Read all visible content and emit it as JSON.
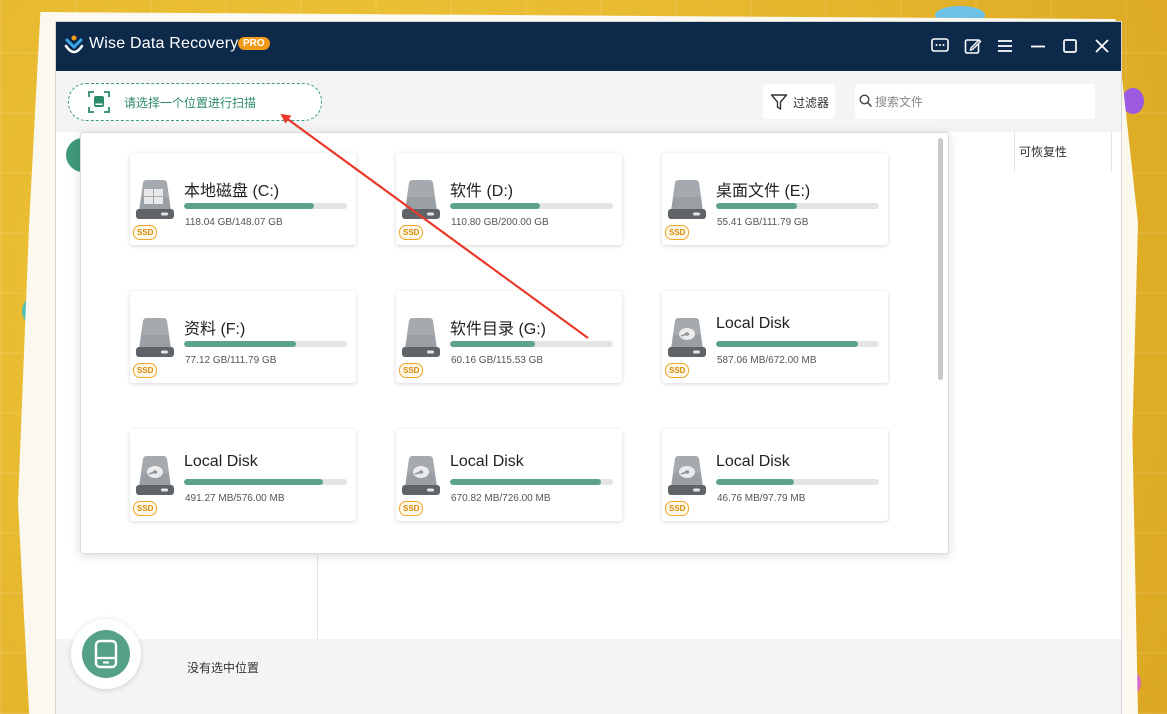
{
  "app": {
    "title": "Wise Data Recovery",
    "badge": "PRO"
  },
  "toolbar": {
    "location_label": "请选择一个位置进行扫描",
    "filter_label": "过滤器",
    "search_placeholder": "搜索文件"
  },
  "table": {
    "column_recoverability": "可恢复性"
  },
  "status": {
    "no_location": "没有选中位置"
  },
  "drives": [
    {
      "name": "本地磁盘 (C:)",
      "size": "118.04 GB/148.07 GB",
      "used_fraction": 0.797,
      "type": "SSD",
      "icon": "windows-drive-icon"
    },
    {
      "name": "软件 (D:)",
      "size": "110.80 GB/200.00 GB",
      "used_fraction": 0.554,
      "type": "SSD",
      "icon": "hard-drive-icon"
    },
    {
      "name": "桌面文件 (E:)",
      "size": "55.41 GB/111.79 GB",
      "used_fraction": 0.496,
      "type": "SSD",
      "icon": "hard-drive-icon"
    },
    {
      "name": "资料 (F:)",
      "size": "77.12 GB/111.79 GB",
      "used_fraction": 0.69,
      "type": "SSD",
      "icon": "hard-drive-icon"
    },
    {
      "name": "软件目录 (G:)",
      "size": "60.16 GB/115.53 GB",
      "used_fraction": 0.521,
      "type": "SSD",
      "icon": "hard-drive-icon"
    },
    {
      "name": "Local Disk",
      "size": "587.06 MB/672.00 MB",
      "used_fraction": 0.874,
      "type": "SSD",
      "icon": "disk-platter-icon"
    },
    {
      "name": "Local Disk",
      "size": "491.27 MB/576.00 MB",
      "used_fraction": 0.853,
      "type": "SSD",
      "icon": "disk-platter-icon"
    },
    {
      "name": "Local Disk",
      "size": "670.82 MB/726.00 MB",
      "used_fraction": 0.924,
      "type": "SSD",
      "icon": "disk-platter-icon"
    },
    {
      "name": "Local Disk",
      "size": "46.76 MB/97.79 MB",
      "used_fraction": 0.478,
      "type": "SSD",
      "icon": "disk-platter-icon"
    }
  ],
  "colors": {
    "titlebar": "#0d2a4b",
    "accent_green": "#5da28a",
    "badge_orange": "#f29a1a",
    "annotation_arrow": "#e8392b"
  }
}
